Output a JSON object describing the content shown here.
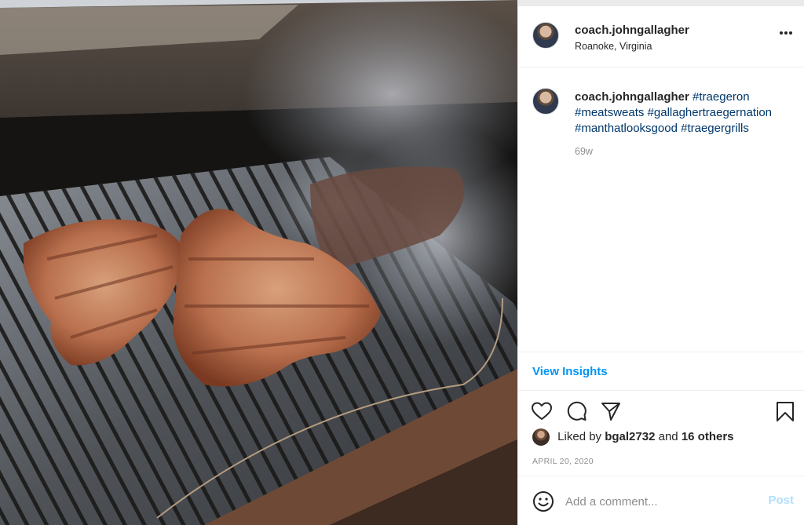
{
  "post": {
    "username": "coach.johngallagher",
    "location": "Roanoke, Virginia"
  },
  "caption": {
    "username": "coach.johngallagher",
    "hashtags": [
      "#traegeron",
      "#meatsweats",
      "#gallaghertraegernation",
      "#manthatlooksgood",
      "#traegergrills"
    ],
    "age": "69w"
  },
  "insights": {
    "label": "View Insights"
  },
  "likes": {
    "prefix": "Liked by",
    "first_user": "bgal2732",
    "joiner": "and",
    "others": "16 others"
  },
  "date": "APRIL 20, 2020",
  "comment": {
    "placeholder": "Add a comment...",
    "post_label": "Post"
  },
  "icons": {
    "more": "more-options-icon",
    "like": "heart-icon",
    "comment": "comment-icon",
    "share": "share-icon",
    "save": "bookmark-icon",
    "emoji": "emoji-icon"
  },
  "colors": {
    "link": "#0095f6",
    "hashtag": "#00376b",
    "muted": "#8e8e8e"
  }
}
